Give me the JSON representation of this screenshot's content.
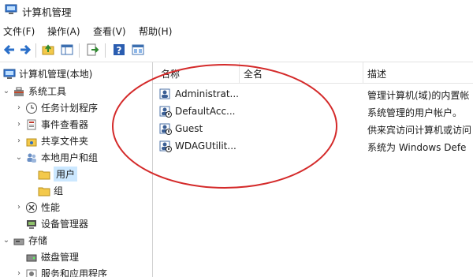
{
  "window": {
    "title": "计算机管理"
  },
  "menu": [
    {
      "label": "文件(F)"
    },
    {
      "label": "操作(A)"
    },
    {
      "label": "查看(V)"
    },
    {
      "label": "帮助(H)"
    }
  ],
  "toolbar": {
    "buttons": [
      "back-icon",
      "forward-icon",
      "up-folder-icon",
      "show-hide-tree-icon",
      "export-list-icon",
      "help-icon",
      "properties-icon"
    ]
  },
  "tree": {
    "root": "计算机管理(本地)",
    "items": [
      {
        "label": "系统工具",
        "icon": "toolbox-icon",
        "expanded": true
      },
      {
        "label": "任务计划程序",
        "icon": "clock-icon"
      },
      {
        "label": "事件查看器",
        "icon": "event-viewer-icon"
      },
      {
        "label": "共享文件夹",
        "icon": "shared-folder-icon"
      },
      {
        "label": "本地用户和组",
        "icon": "users-group-icon",
        "expanded": true
      },
      {
        "label": "用户",
        "icon": "folder-icon",
        "selected": true
      },
      {
        "label": "组",
        "icon": "folder-icon"
      },
      {
        "label": "性能",
        "icon": "performance-icon"
      },
      {
        "label": "设备管理器",
        "icon": "device-manager-icon"
      },
      {
        "label": "存储",
        "icon": "storage-icon",
        "expanded": true
      },
      {
        "label": "磁盘管理",
        "icon": "disk-icon"
      },
      {
        "label": "服务和应用程序",
        "icon": "services-icon"
      }
    ]
  },
  "list": {
    "columns": [
      "名称",
      "全名",
      "描述"
    ],
    "rows": [
      {
        "name": "Administrat...",
        "fullname": "",
        "desc": "管理计算机(域)的内置帐"
      },
      {
        "name": "DefaultAcc...",
        "fullname": "",
        "desc": "系统管理的用户帐户。"
      },
      {
        "name": "Guest",
        "fullname": "",
        "desc": "供来宾访问计算机或访问"
      },
      {
        "name": "WDAGUtilit...",
        "fullname": "",
        "desc": "系统为 Windows Defe"
      }
    ]
  },
  "colors": {
    "annotation": "#d42a2a",
    "selection": "#cce8ff",
    "folder": "#f3c94b"
  }
}
